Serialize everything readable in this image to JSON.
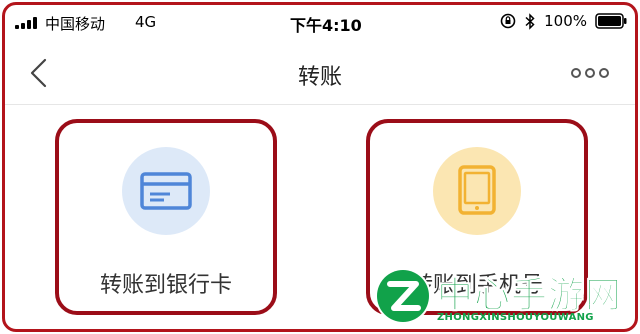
{
  "status_bar": {
    "carrier": "中国移动",
    "network": "4G",
    "time": "下午4:10",
    "battery": "100%",
    "icons": [
      "signal-icon",
      "rotation-lock-icon",
      "bluetooth-icon",
      "battery-icon"
    ]
  },
  "nav": {
    "title": "转账",
    "back_icon": "chevron-left-icon",
    "more_icon": "more-dots-icon"
  },
  "actions": [
    {
      "label": "转账到银行卡",
      "icon": "bank-card-icon",
      "color": "#4f86d8",
      "bg": "#dde9f8"
    },
    {
      "label": "转账到手机号",
      "icon": "tablet-phone-icon",
      "color": "#f2b232",
      "bg": "#fbe6b2"
    }
  ],
  "highlight_color": "#9b0d18",
  "watermark": {
    "name": "中心手游网",
    "sub": "ZHONGXINSHOUYOUWANG"
  }
}
